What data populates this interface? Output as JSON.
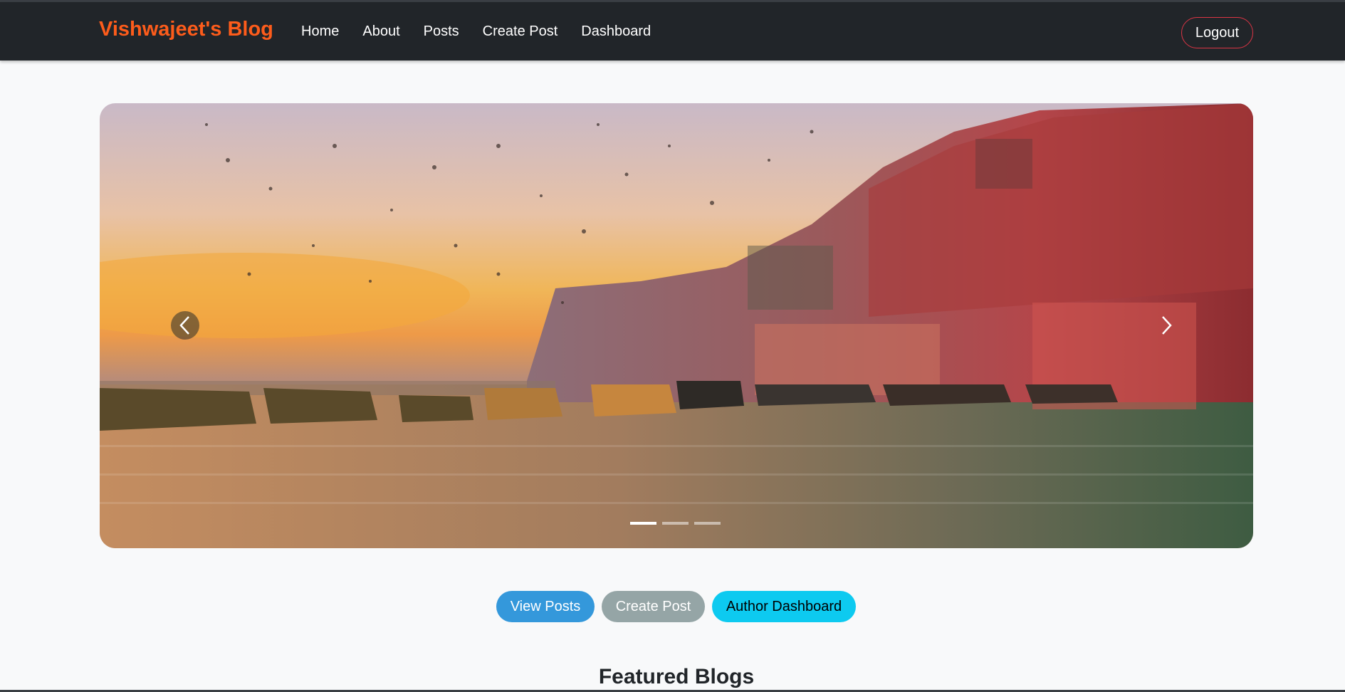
{
  "navbar": {
    "brand": "Vishwajeet's Blog",
    "links": [
      {
        "label": "Home"
      },
      {
        "label": "About"
      },
      {
        "label": "Posts"
      },
      {
        "label": "Create Post"
      },
      {
        "label": "Dashboard"
      }
    ],
    "logout_label": "Logout",
    "colors": {
      "background": "#212529",
      "brand": "#fd5c1b",
      "logout_border": "#dc3545"
    }
  },
  "carousel": {
    "image": "sunset-river-ghats-with-boats",
    "prev_icon": "chevron-left-icon",
    "next_icon": "chevron-right-icon",
    "slide_count": 3,
    "active_slide": 1
  },
  "actions": {
    "view_posts": "View Posts",
    "create_post": "Create Post",
    "author_dashboard": "Author Dashboard",
    "colors": {
      "primary": "#3498db",
      "secondary": "#95a5a6",
      "info": "#0dcaf0"
    }
  },
  "featured": {
    "title": "Featured Blogs"
  }
}
